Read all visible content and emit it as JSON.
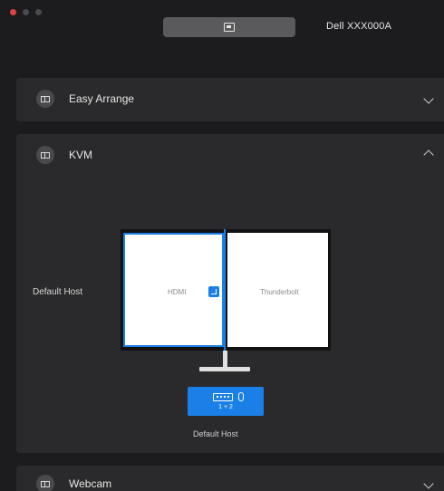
{
  "titlebar": {
    "device_name": "Dell XXX000A",
    "monitor_tab_icon": "monitor-icon"
  },
  "panels": [
    {
      "title": "Easy Arrange",
      "icon": "easy-arrange-icon",
      "expanded": false
    },
    {
      "title": "KVM",
      "icon": "kvm-icon",
      "expanded": true
    },
    {
      "title": "Webcam",
      "icon": "webcam-icon",
      "expanded": false
    }
  ],
  "kvm": {
    "host_label": "Default Host",
    "left_source": "HDMI",
    "right_source": "Thunderbolt",
    "keyboard_caption": "1 + 2",
    "keyboard_label": "Default Host",
    "accent_color": "#1b7fe8"
  }
}
